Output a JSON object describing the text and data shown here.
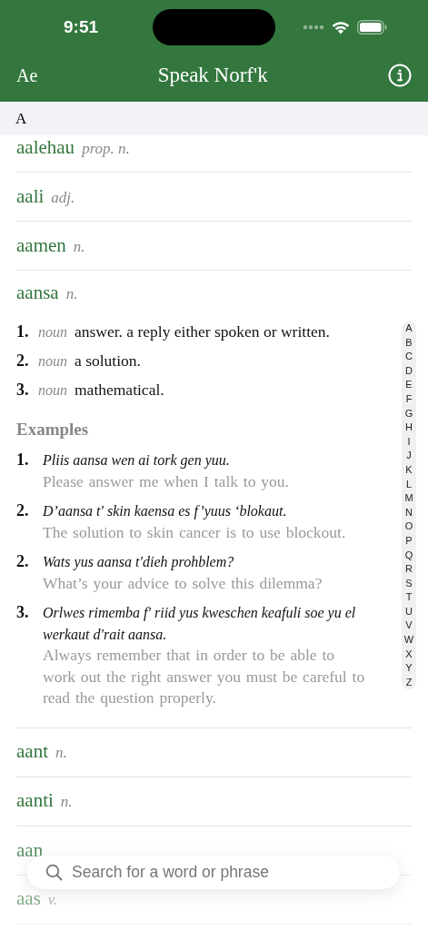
{
  "status_bar": {
    "time": "9:51"
  },
  "nav": {
    "left_button": "Ae",
    "title": "Speak Norf'k"
  },
  "section_header": "A",
  "entries": [
    {
      "word": "aalehau",
      "pos": "prop. n."
    },
    {
      "word": "aali",
      "pos": "adj."
    },
    {
      "word": "aamen",
      "pos": "n."
    },
    {
      "word": "aansa",
      "pos": "n.",
      "senses": [
        {
          "number": "1.",
          "pos": "noun",
          "text": "answer. a reply either spoken or written."
        },
        {
          "number": "2.",
          "pos": "noun",
          "text": "a solution."
        },
        {
          "number": "3.",
          "pos": "noun",
          "text": "mathematical."
        }
      ],
      "examples_heading": "Examples",
      "examples": [
        {
          "number": "1.",
          "phrase": "Pliis aansa wen ai tork gen yuu.",
          "translation": "Please answer me when I talk to you."
        },
        {
          "number": "2.",
          "phrase": "D’aansa t' skin kaensa es f’yuus ‘blokaut.",
          "translation": "The solution to skin cancer is to use blockout."
        },
        {
          "number": "2.",
          "phrase": "Wats yus aansa t'dieh prohblem?",
          "translation": "What’s your advice to solve this dilemma?"
        },
        {
          "number": "3.",
          "phrase": "Orlwes rimemba f' riid yus kweschen keafuli soe yu el werkaut d'rait aansa.",
          "translation": "Always remember that in order to be able to work out the right answer you must be careful to read the question properly."
        }
      ]
    },
    {
      "word": "aant",
      "pos": "n."
    },
    {
      "word": "aanti",
      "pos": "n."
    },
    {
      "word": "aan"
    },
    {
      "word": "aas",
      "pos": "v."
    }
  ],
  "index": [
    "A",
    "B",
    "C",
    "D",
    "E",
    "F",
    "G",
    "H",
    "I",
    "J",
    "K",
    "L",
    "M",
    "N",
    "O",
    "P",
    "Q",
    "R",
    "S",
    "T",
    "U",
    "V",
    "W",
    "X",
    "Y",
    "Z"
  ],
  "search": {
    "placeholder": "Search for a word or phrase"
  }
}
